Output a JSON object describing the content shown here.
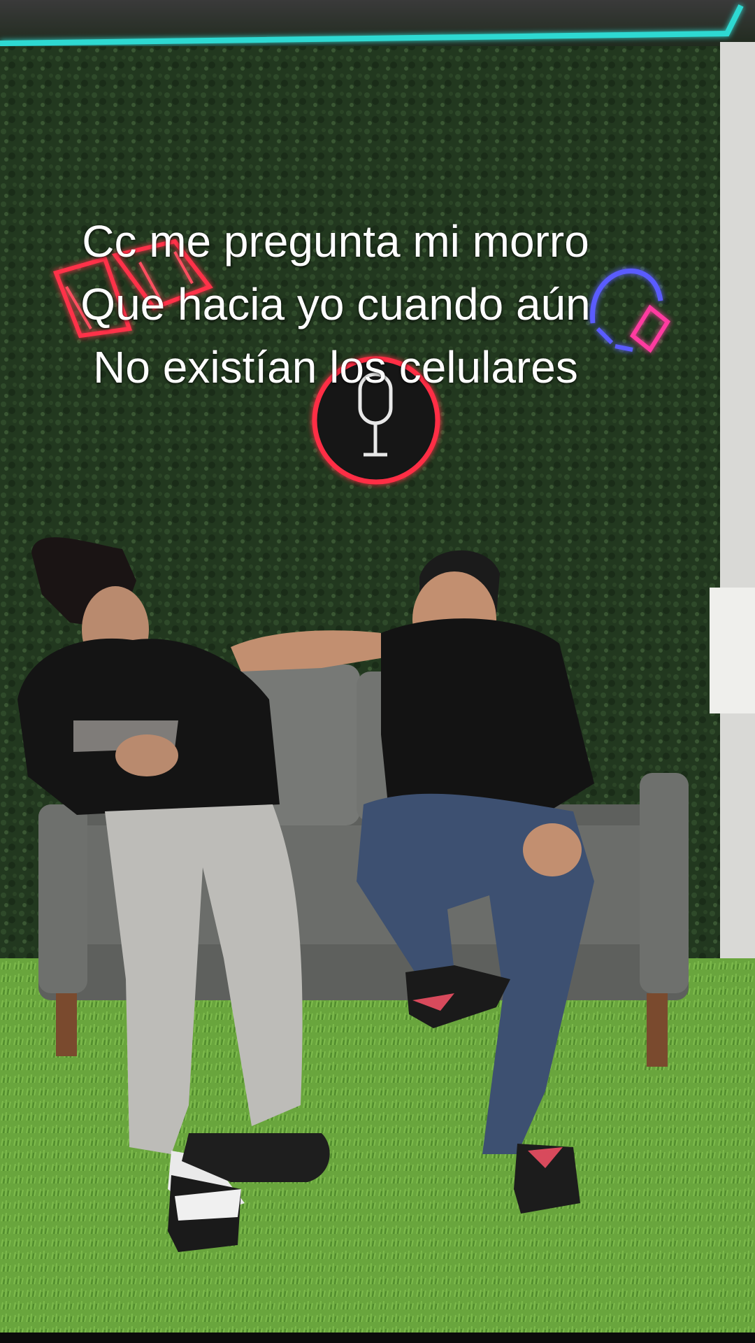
{
  "video": {
    "caption_lines": [
      "Cc me pregunta mi morro",
      "Que hacia yo cuando aún",
      "No existían los celulares"
    ],
    "colors": {
      "wall": "#233a22",
      "turf": "#6aa83e",
      "neon_strip": "#2fd9d2",
      "neon_red": "#ff3048",
      "neon_blue": "#5a5cff",
      "sofa": "#6b6d6a"
    }
  }
}
